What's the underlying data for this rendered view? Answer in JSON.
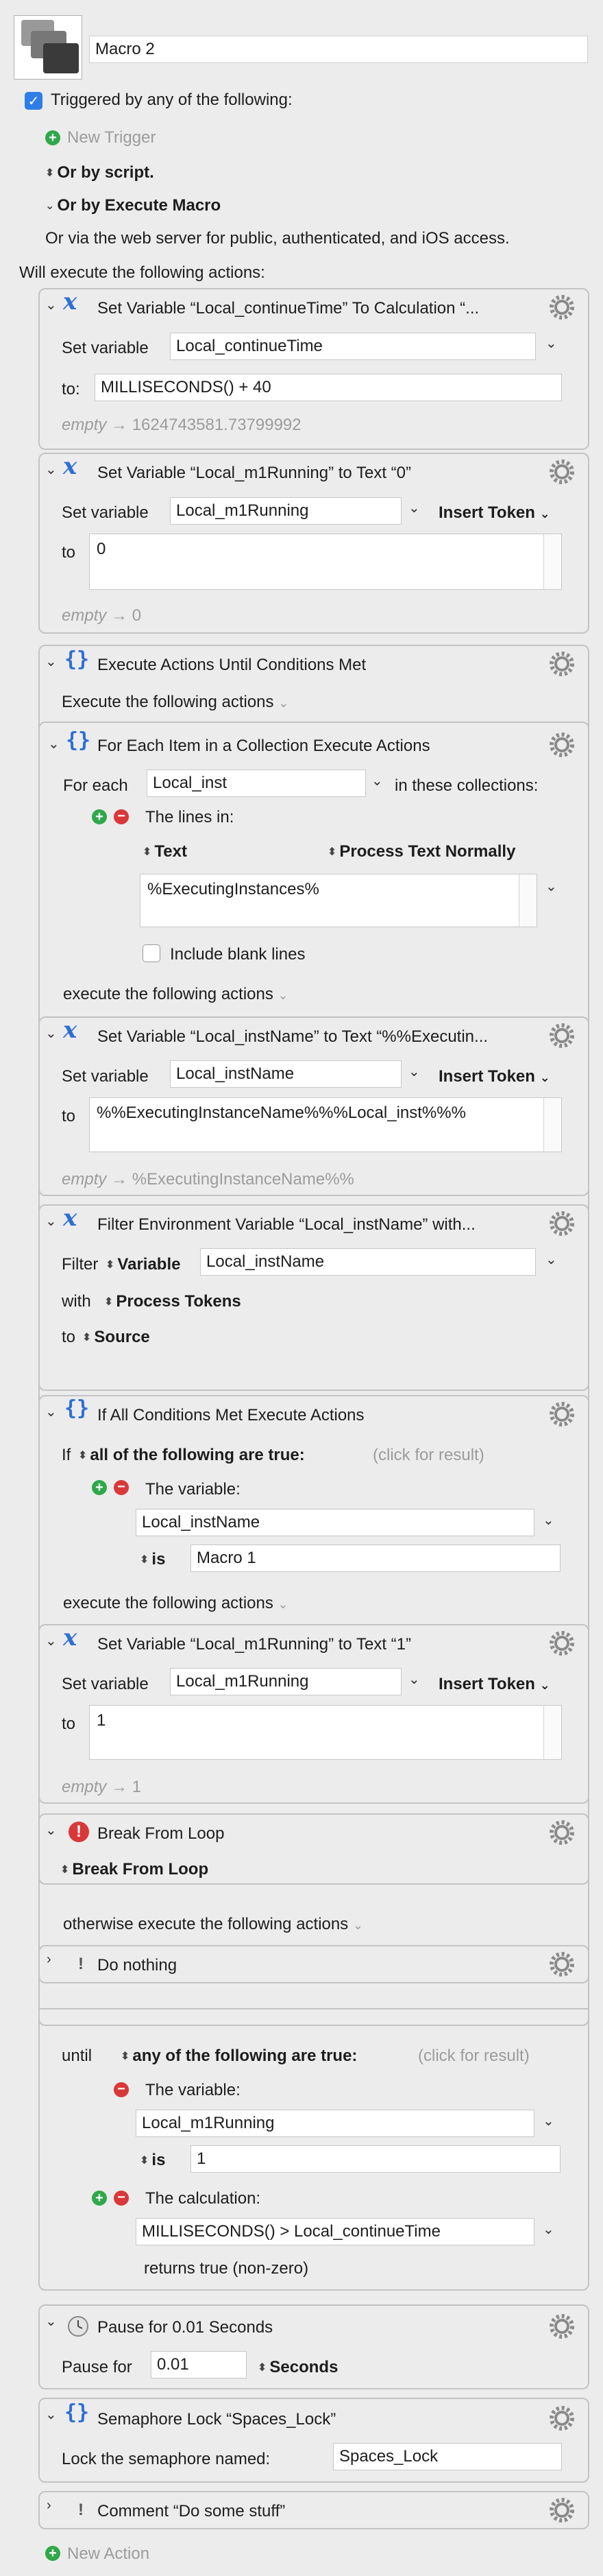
{
  "macro": {
    "name": "Macro 2",
    "triggered_label": "Triggered by any of the following:",
    "new_trigger": "New Trigger",
    "or_by_script": "Or by script.",
    "or_by_execute": "Or by Execute Macro",
    "or_via_web": "Or via the web server for public, authenticated, and iOS access.",
    "will_execute": "Will execute the following actions:",
    "new_action": "New Action"
  },
  "common": {
    "set_variable": "Set variable",
    "to_colon": "to:",
    "to": "to",
    "insert_token": "Insert Token",
    "execute_following": "execute the following actions",
    "empty": "empty",
    "arrow": "→",
    "the_variable": "The variable:",
    "is": "is",
    "click_for_result": "(click for result)",
    "gear": "gear-icon"
  },
  "a1": {
    "title": "Set Variable “Local_continueTime” To Calculation “...",
    "var": "Local_continueTime",
    "value": "MILLISECONDS() + 40",
    "result": "1624743581.73799992"
  },
  "a2": {
    "title": "Set Variable “Local_m1Running” to Text “0”",
    "var": "Local_m1Running",
    "value": "0",
    "result": "0"
  },
  "a3": {
    "title": "Execute Actions Until Conditions Met",
    "execute": "Execute the following actions"
  },
  "a4": {
    "title": "For Each Item in a Collection Execute Actions",
    "for_each": "For each",
    "var": "Local_inst",
    "in_these": "in these collections:",
    "lines_in": "The lines in:",
    "text": "Text",
    "process": "Process Text Normally",
    "value": "%ExecutingInstances%",
    "include_blank": "Include blank lines"
  },
  "a5": {
    "title": "Set Variable “Local_instName” to Text “%%Executin...",
    "var": "Local_instName",
    "value": "%%ExecutingInstanceName%%%Local_inst%%%",
    "result": "%ExecutingInstanceName%%"
  },
  "a6": {
    "title": "Filter Environment Variable “Local_instName” with...",
    "filter": "Filter",
    "variable": "Variable",
    "var": "Local_instName",
    "with": "with",
    "process_tokens": "Process Tokens",
    "to": "to",
    "source": "Source"
  },
  "a7": {
    "title": "If All Conditions Met Execute Actions",
    "if": "If",
    "all_true": "all of the following are true:",
    "var": "Local_instName",
    "cmp": "Macro 1",
    "otherwise": "otherwise execute the following actions"
  },
  "a8": {
    "title": "Set Variable “Local_m1Running” to Text “1”",
    "var": "Local_m1Running",
    "value": "1",
    "result": "1"
  },
  "a9": {
    "title": "Break From Loop",
    "sub": "Break From Loop"
  },
  "a10": {
    "title": "Do nothing"
  },
  "until": {
    "until": "until",
    "any_true": "any of the following are true:",
    "var": "Local_m1Running",
    "cmp": "1",
    "calc_label": "The calculation:",
    "calc": "MILLISECONDS() > Local_continueTime",
    "returns": "returns true (non-zero)"
  },
  "a11": {
    "title": "Pause for 0.01 Seconds",
    "pause_for": "Pause for",
    "value": "0.01",
    "unit": "Seconds"
  },
  "a12": {
    "title": "Semaphore Lock “Spaces_Lock”",
    "lock_label": "Lock the semaphore named:",
    "value": "Spaces_Lock"
  },
  "a13": {
    "title": "Comment “Do some stuff”"
  },
  "colors": {
    "accent": "#2f6fd4",
    "add": "#2fa84a",
    "remove": "#d9383a",
    "break": "#d9383a"
  }
}
